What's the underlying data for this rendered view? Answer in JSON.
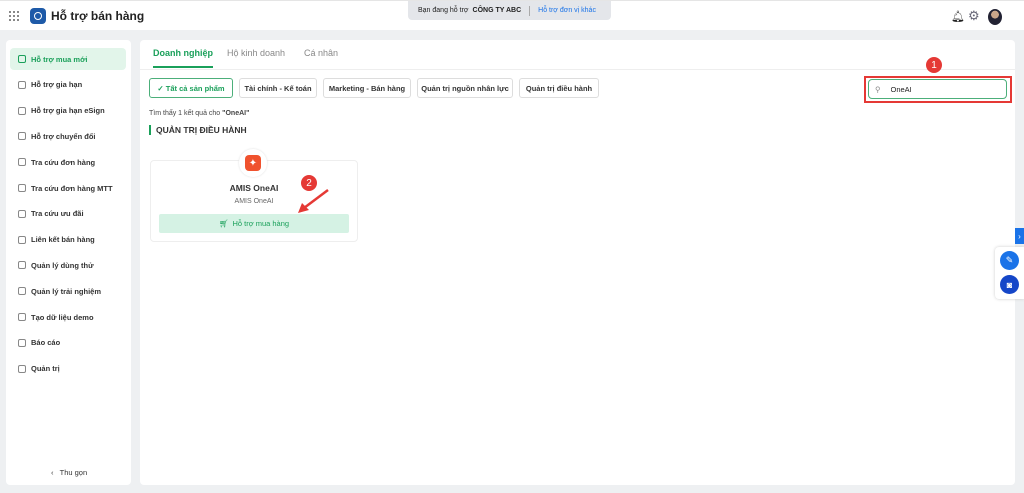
{
  "header": {
    "title": "Hỗ trợ bán hàng",
    "support_prefix": "Bạn đang hỗ trợ",
    "company": "CÔNG TY ABC",
    "switch_link": "Hỗ trợ đơn vị khác"
  },
  "sidebar": {
    "items": [
      {
        "label": "Hỗ trợ mua mới",
        "active": true
      },
      {
        "label": "Hỗ trợ gia hạn"
      },
      {
        "label": "Hỗ trợ gia hạn eSign"
      },
      {
        "label": "Hỗ trợ chuyển đổi"
      },
      {
        "label": "Tra cứu đơn hàng"
      },
      {
        "label": "Tra cứu đơn hàng MTT"
      },
      {
        "label": "Tra cứu ưu đãi"
      },
      {
        "label": "Liên kết bán hàng"
      },
      {
        "label": "Quản lý dùng thử"
      },
      {
        "label": "Quản lý trải nghiệm"
      },
      {
        "label": "Tạo dữ liệu demo"
      },
      {
        "label": "Báo cáo"
      },
      {
        "label": "Quản trị"
      }
    ],
    "collapse": "Thu gọn"
  },
  "tabs": [
    "Doanh nghiệp",
    "Hộ kinh doanh",
    "Cá nhân"
  ],
  "filters": [
    "Tất cả sản phẩm",
    "Tài chính - Kế toán",
    "Marketing - Bán hàng",
    "Quản trị nguồn nhân lực",
    "Quản trị điều hành"
  ],
  "search": {
    "value": "OneAI"
  },
  "result": {
    "prefix": "Tìm thấy 1 kết quả cho ",
    "query": "\"OneAI\""
  },
  "section": "QUẢN TRỊ ĐIỀU HÀNH",
  "card": {
    "title": "AMIS OneAI",
    "subtitle": "AMIS OneAI",
    "button": "Hỗ trợ mua hàng"
  },
  "annotations": [
    "1",
    "2"
  ],
  "colors": {
    "accent": "#1aa05a",
    "highlight": "#e53935",
    "link": "#1a73e8"
  }
}
